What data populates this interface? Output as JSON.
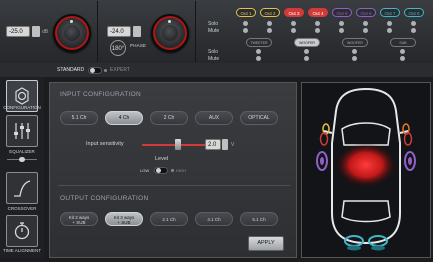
{
  "top": {
    "left_value": "-25.0",
    "left_unit": "dB",
    "mid_value": "-24.0",
    "mid_unit": "dB",
    "phase_label": "PHASE",
    "phase_value": "180°",
    "solo_label": "Solo",
    "mute_label": "Mute",
    "outputs": [
      {
        "label": "Out 1",
        "color": "#e0c24a",
        "active": false
      },
      {
        "label": "Out 2",
        "color": "#e0c24a",
        "active": false
      },
      {
        "label": "Out 3",
        "color": "#d23a3a",
        "active": true
      },
      {
        "label": "Out 4",
        "color": "#d23a3a",
        "active": true
      },
      {
        "label": "Out 5",
        "color": "#8f5fc8",
        "active": false
      },
      {
        "label": "Out 6",
        "color": "#8f5fc8",
        "active": false
      },
      {
        "label": "Out 7",
        "color": "#3fb7c8",
        "active": false
      },
      {
        "label": "Out 8",
        "color": "#3fb7c8",
        "active": false
      }
    ],
    "groups": [
      {
        "label": "TWEETER",
        "active": false
      },
      {
        "label": "WOOFER",
        "active": true
      },
      {
        "label": "WOOFER",
        "active": false
      },
      {
        "label": "SUB",
        "active": false
      }
    ]
  },
  "mode": {
    "standard": "STANDARD",
    "expert": "EXPERT"
  },
  "sidebar": [
    {
      "label": "CONFIGURATION",
      "icon": "gear-icon",
      "active": true
    },
    {
      "label": "EQUALIZER",
      "icon": "equalizer-icon",
      "active": false
    },
    {
      "label": "CROSSOVER",
      "icon": "crossover-icon",
      "active": false
    },
    {
      "label": "TIME ALIGNMENT",
      "icon": "stopwatch-icon",
      "active": false
    }
  ],
  "input": {
    "title": "INPUT CONFIGURATION",
    "buttons": [
      {
        "label": "5.1 Ch",
        "selected": false
      },
      {
        "label": "4 Ch",
        "selected": true
      },
      {
        "label": "2 Ch",
        "selected": false
      },
      {
        "label": "AUX",
        "selected": false
      },
      {
        "label": "OPTICAL",
        "selected": false
      }
    ],
    "sensitivity_label": "Input sensitivity",
    "sensitivity_value": "2.0",
    "sensitivity_unit": "V",
    "level_label": "Level",
    "level_low": "LOW",
    "level_high": "HIGH"
  },
  "output": {
    "title": "OUTPUT CONFIGURATION",
    "buttons": [
      {
        "line1": "Kit 2 ways",
        "line2": "+ SUB",
        "selected": false
      },
      {
        "line1": "Kit 3 ways",
        "line2": "+ SUB",
        "selected": true
      },
      {
        "line1": "2.1 Ch",
        "line2": "",
        "selected": false
      },
      {
        "line1": "4.1 Ch",
        "line2": "",
        "selected": false
      },
      {
        "line1": "5.1 Ch",
        "line2": "",
        "selected": false
      }
    ],
    "apply_label": "APPLY"
  },
  "colors": {
    "accent_red": "#d23a3a",
    "yellow": "#e0c24a",
    "orange": "#e07a2a",
    "purple": "#8f5fc8",
    "cyan": "#3fb7c8"
  }
}
